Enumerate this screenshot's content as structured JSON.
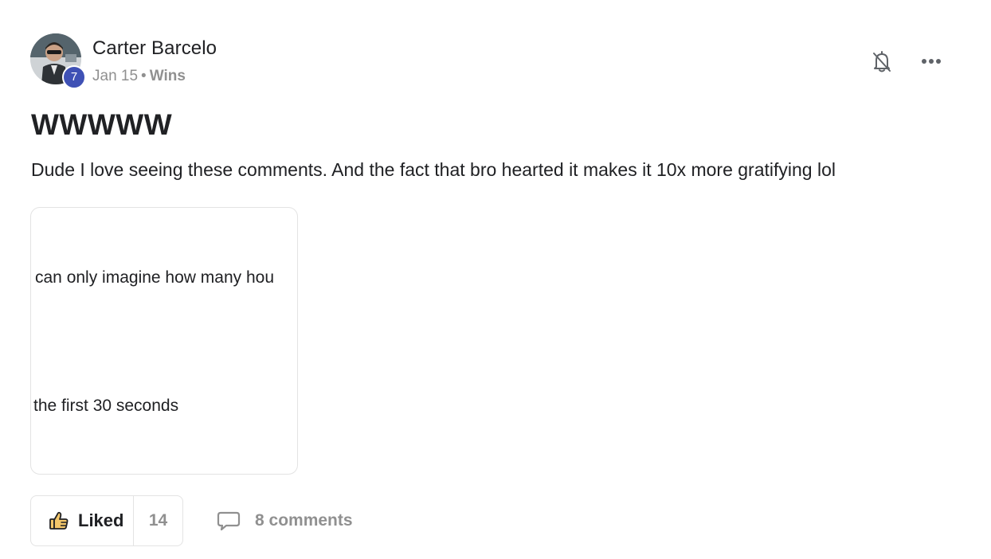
{
  "post": {
    "author": {
      "name": "Carter Barcelo",
      "level": "7"
    },
    "meta": {
      "date": "Jan 15",
      "separator": "•",
      "category": "Wins"
    },
    "title": "WWWWW",
    "body": "Dude I love seeing these comments. And the fact that bro hearted it makes it 10x more gratifying lol",
    "attachment": {
      "lines": [
        "can only imagine how many hou",
        "the first 30 seconds"
      ]
    },
    "actions": {
      "like_label": "Liked",
      "like_count": "14",
      "comments_label": "8 comments"
    },
    "icons": {
      "bell": "bell-off-icon",
      "more": "more-horizontal-icon",
      "like": "thumbs-up-icon",
      "comment": "comment-bubble-icon"
    },
    "colors": {
      "level_badge": "#3f51b5",
      "muted_text": "#909090",
      "thumb_fill": "#f4c76a",
      "border": "#e3e3e3"
    }
  }
}
